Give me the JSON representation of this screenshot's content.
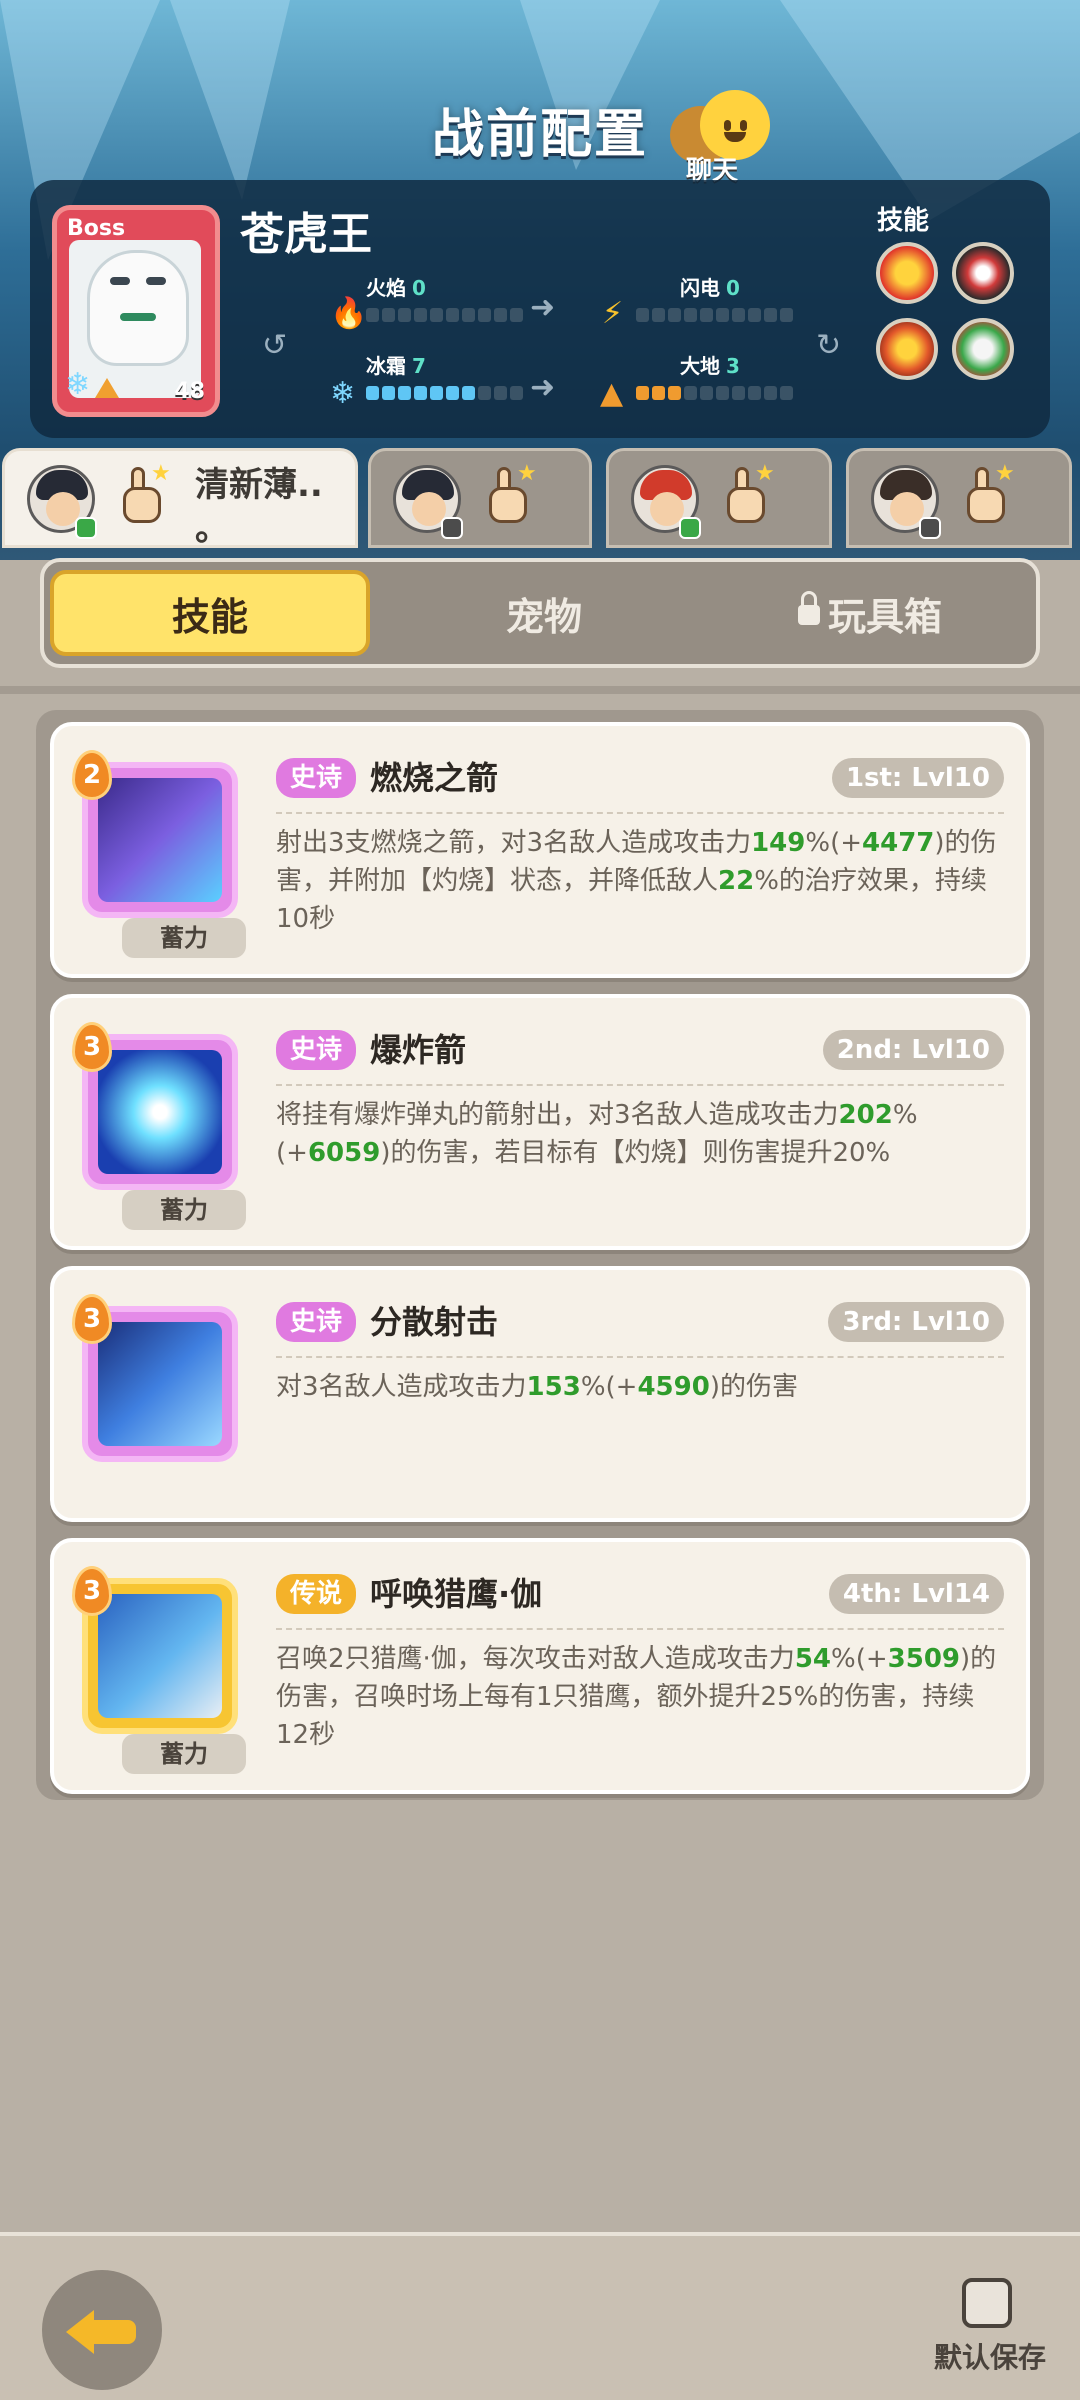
{
  "header": {
    "title": "战前配置",
    "chat_label": "聊天"
  },
  "boss": {
    "badge": "Boss",
    "name": "苍虎王",
    "level": "48",
    "elements": {
      "fire": {
        "label": "火焰",
        "value": "0",
        "icon": "fire-icon"
      },
      "lightning": {
        "label": "闪电",
        "value": "0",
        "icon": "lightning-icon"
      },
      "frost": {
        "label": "冰霜",
        "value": "7",
        "icon": "snowflake-icon"
      },
      "earth": {
        "label": "大地",
        "value": "3",
        "icon": "mountain-icon"
      }
    },
    "skills_label": "技能"
  },
  "team_tabs": [
    {
      "name": "清新薄..\n。",
      "active": true
    },
    {
      "name": "",
      "active": false
    },
    {
      "name": "",
      "active": false
    },
    {
      "name": "",
      "active": false
    }
  ],
  "segments": {
    "skills": "技能",
    "pets": "宠物",
    "toybox": "玩具箱"
  },
  "skills": [
    {
      "level": "2",
      "rarity": "史诗",
      "name": "燃烧之箭",
      "slot": "1st: Lvl10",
      "charge": "蓄力",
      "desc_a": "射出3支燃烧之箭，对3名敌人造成攻击力",
      "g1": "149",
      "desc_b": "%(+",
      "g2": "4477",
      "desc_c": ")的伤害，并附加【灼烧】状态，并降低敌人",
      "g3": "22",
      "desc_d": "%的治疗效果，持续10秒"
    },
    {
      "level": "3",
      "rarity": "史诗",
      "name": "爆炸箭",
      "slot": "2nd: Lvl10",
      "charge": "蓄力",
      "desc_a": "将挂有爆炸弹丸的箭射出，对3名敌人造成攻击力",
      "g1": "202",
      "desc_b": "%(+",
      "g2": "6059",
      "desc_c": ")的伤害，若目标有【灼烧】则伤害提升20%"
    },
    {
      "level": "3",
      "rarity": "史诗",
      "name": "分散射击",
      "slot": "3rd: Lvl10",
      "desc_a": "对3名敌人造成攻击力",
      "g1": "153",
      "desc_b": "%(+",
      "g2": "4590",
      "desc_c": ")的伤害"
    },
    {
      "level": "3",
      "rarity": "传说",
      "name": "呼唤猎鹰·伽",
      "slot": "4th: Lvl14",
      "charge": "蓄力",
      "desc_a": "召唤2只猎鹰·伽，每次攻击对敌人造成攻击力",
      "g1": "54",
      "desc_b": "%(+",
      "g2": "3509",
      "desc_c": ")的伤害，召唤时场上每有1只猎鹰，额外提升25%的伤害，持续12秒"
    }
  ],
  "footer": {
    "default_save": "默认保存"
  },
  "colors": {
    "accent_yellow": "#ffe36a",
    "epic": "#e07ae0",
    "legend": "#f4b22a",
    "value_green": "#2f9c2c"
  }
}
